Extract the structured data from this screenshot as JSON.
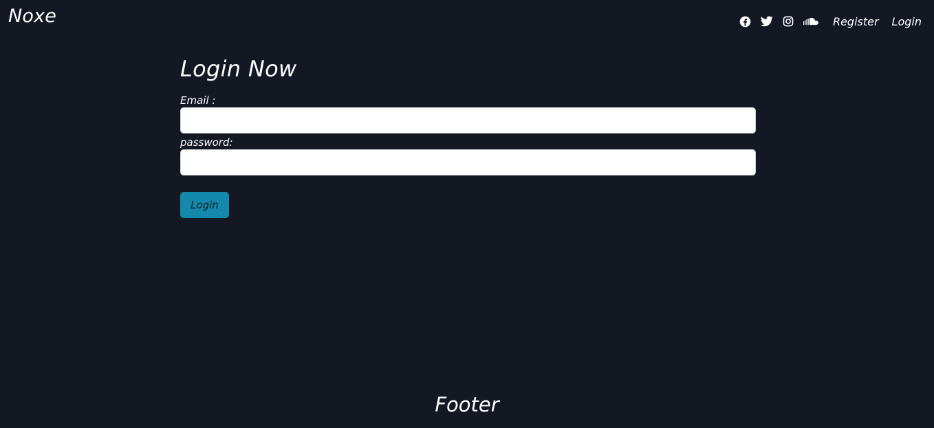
{
  "navbar": {
    "brand": "Noxe",
    "social_icons": [
      "facebook-icon",
      "twitter-icon",
      "instagram-icon",
      "soundcloud-icon"
    ],
    "links": [
      {
        "label": "Register"
      },
      {
        "label": "Login"
      }
    ]
  },
  "form": {
    "title": "Login Now",
    "email_label": "Email :",
    "email_value": "",
    "password_label": "password:",
    "password_value": "",
    "submit_label": "Login"
  },
  "footer": {
    "text": "Footer"
  },
  "colors": {
    "background": "#141823",
    "accent": "#1489ab",
    "text": "#ffffff"
  }
}
